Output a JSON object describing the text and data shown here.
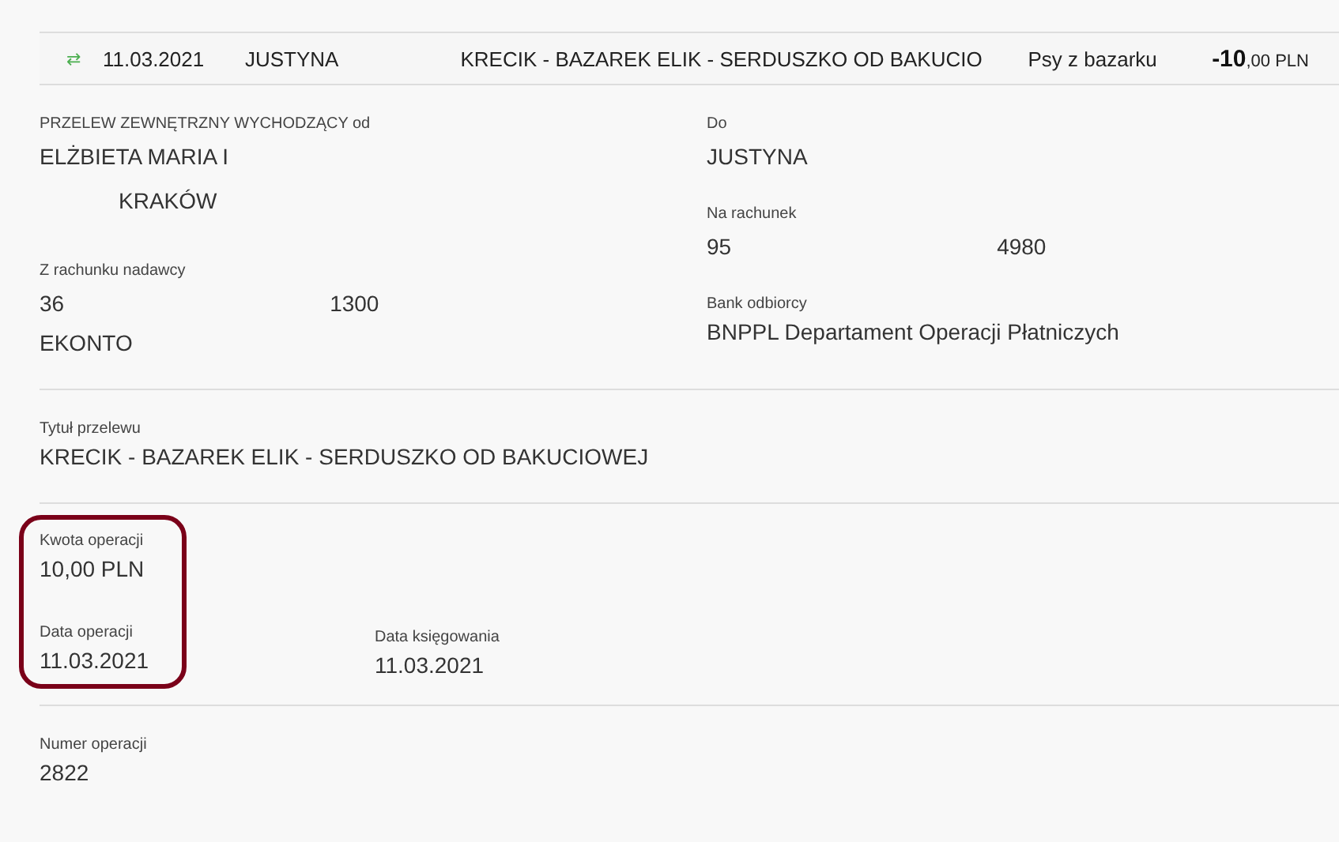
{
  "transaction_row": {
    "icon": "⇄",
    "date": "11.03.2021",
    "counterparty": "JUSTYNA",
    "title": "KRECIK - BAZAREK ELIK - SERDUSZKO OD BAKUCIO",
    "category": "Psy z bazarku",
    "amount_whole": "-10",
    "amount_fraction": ",00 PLN"
  },
  "sender": [
    {
      "label": "PRZELEW ZEWNĘTRZNY WYCHODZĄCY od",
      "lines": [
        [
          {
            "text": "ELŻBIETA MARIA I"
          },
          {
            "kind": "redaction"
          }
        ],
        [
          {
            "kind": "redaction"
          },
          {
            "text": "KRAKÓW"
          }
        ]
      ]
    },
    {
      "label": "Z rachunku nadawcy",
      "lines": [
        [
          {
            "text": "36"
          },
          {
            "kind": "redaction"
          },
          {
            "text": "1300"
          }
        ],
        [
          {
            "text": "EKONTO"
          }
        ]
      ]
    }
  ],
  "recipient": [
    {
      "label": "Do",
      "lines": [
        [
          {
            "text": "JUSTYNA"
          },
          {
            "kind": "redaction"
          }
        ]
      ]
    },
    {
      "label": "Na rachunek",
      "lines": [
        [
          {
            "text": "95"
          },
          {
            "kind": "redaction"
          },
          {
            "text": "4980"
          }
        ]
      ]
    },
    {
      "label": "Bank odbiorcy",
      "lines": [
        [
          {
            "text": "BNPPL Departament Operacji Płatniczych"
          }
        ]
      ]
    }
  ],
  "transfer_title": {
    "label": "Tytuł przelewu",
    "value": "KRECIK - BAZAREK ELIK - SERDUSZKO OD BAKUCIOWEJ"
  },
  "amounts": {
    "highlighted": true,
    "amount": {
      "label": "Kwota operacji",
      "value": "10,00 PLN"
    },
    "operation_date": {
      "label": "Data operacji",
      "value": "11.03.2021"
    },
    "booking_date": {
      "label": "Data księgowania",
      "value": "11.03.2021"
    }
  },
  "operation_number": {
    "label": "Numer operacji",
    "value": "2822"
  }
}
